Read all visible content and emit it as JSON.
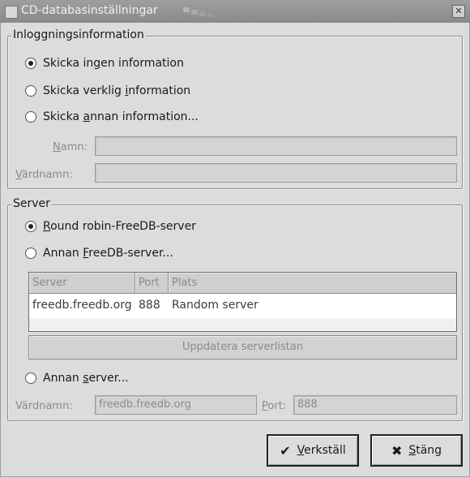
{
  "window": {
    "title": "CD-databasinställningar",
    "icons": [
      "window-menu-icon",
      "close-icon"
    ]
  },
  "login_info": {
    "frame_label": "Inloggningsinformation",
    "options": [
      {
        "label_pre": "Skicka in",
        "label_u": "g",
        "label_post": "en information",
        "checked": true
      },
      {
        "label_pre": "Skicka verklig ",
        "label_u": "i",
        "label_post": "nformation",
        "checked": false
      },
      {
        "label_pre": "Skicka ",
        "label_u": "a",
        "label_post": "nnan information...",
        "checked": false
      }
    ],
    "name_label_u": "N",
    "name_label_post": "amn:",
    "name_value": "",
    "host_label_u": "V",
    "host_label_post": "ärdnamn:",
    "host_value": ""
  },
  "server": {
    "frame_label": "Server",
    "options": [
      {
        "label_pre": "",
        "label_u": "R",
        "label_post": "ound robin-FreeDB-server",
        "checked": true
      },
      {
        "label_pre": "Annan ",
        "label_u": "F",
        "label_post": "reeDB-server...",
        "checked": false
      }
    ],
    "list": {
      "columns": [
        "Server",
        "Port",
        "Plats"
      ],
      "rows": [
        {
          "server": "freedb.freedb.org",
          "port": "888",
          "place": "Random server"
        }
      ]
    },
    "update_button": "Uppdatera serverlistan",
    "other_option": {
      "label_pre": "Annan ",
      "label_u": "s",
      "label_post": "erver...",
      "checked": false
    },
    "host_label": "Värdnamn:",
    "host_value": "freedb.freedb.org",
    "port_label_u": "P",
    "port_label_post": "ort:",
    "port_value": "888"
  },
  "buttons": {
    "apply_u": "V",
    "apply_post": "erkställ",
    "close_pre": "",
    "close_u": "S",
    "close_post": "täng"
  }
}
